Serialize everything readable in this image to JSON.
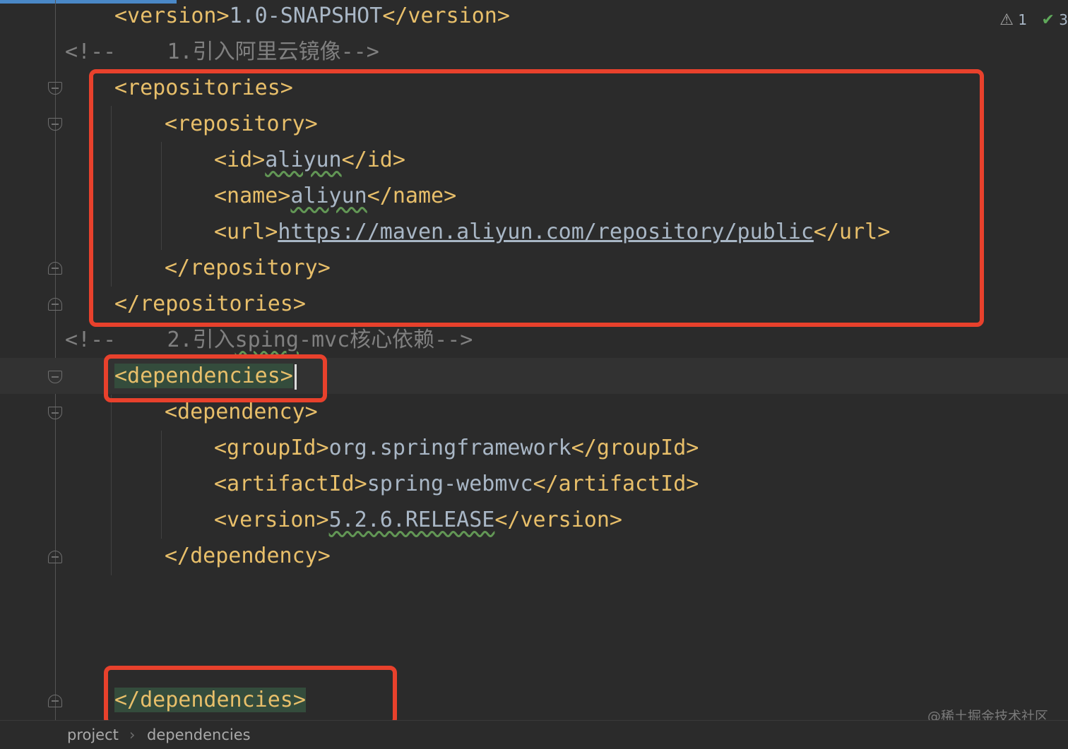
{
  "editor": {
    "lines": [
      {
        "tokens": [
          [
            "tag",
            "<version>"
          ],
          [
            "text",
            "1.0-SNAPSHOT"
          ],
          [
            "tag",
            "</version>"
          ]
        ]
      },
      {
        "tokens": [
          [
            "comment",
            "<!--    1.引入阿里云镜像-->"
          ]
        ]
      },
      {
        "tokens": [
          [
            "tag",
            "<repositories>"
          ]
        ]
      },
      {
        "tokens": [
          [
            "tag",
            "<repository>"
          ]
        ]
      },
      {
        "tokens": [
          [
            "tag",
            "<id>"
          ],
          [
            "text",
            "aliyun"
          ],
          [
            "tag",
            "</id>"
          ]
        ]
      },
      {
        "tokens": [
          [
            "tag",
            "<name>"
          ],
          [
            "text",
            "aliyun"
          ],
          [
            "tag",
            "</name>"
          ]
        ]
      },
      {
        "tokens": [
          [
            "tag",
            "<url>"
          ],
          [
            "text",
            "https://maven.aliyun.com/repository/public"
          ],
          [
            "tag",
            "</url>"
          ]
        ]
      },
      {
        "tokens": [
          [
            "tag",
            "</repository>"
          ]
        ]
      },
      {
        "tokens": [
          [
            "tag",
            "</repositories>"
          ]
        ]
      },
      {
        "tokens": [
          [
            "comment",
            "<!--    2.引入"
          ],
          [
            "comment",
            "sping"
          ],
          [
            "comment",
            "-mvc核心依赖-->"
          ]
        ]
      },
      {
        "tokens": [
          [
            "tag",
            "<dependencies>"
          ]
        ]
      },
      {
        "tokens": [
          [
            "tag",
            "<dependency>"
          ]
        ]
      },
      {
        "tokens": [
          [
            "tag",
            "<groupId>"
          ],
          [
            "text",
            "org.springframework"
          ],
          [
            "tag",
            "</groupId>"
          ]
        ]
      },
      {
        "tokens": [
          [
            "tag",
            "<artifactId>"
          ],
          [
            "text",
            "spring-webmvc"
          ],
          [
            "tag",
            "</artifactId>"
          ]
        ]
      },
      {
        "tokens": [
          [
            "tag",
            "<version>"
          ],
          [
            "text",
            "5.2.6.RELEASE"
          ],
          [
            "tag",
            "</version>"
          ]
        ]
      },
      {
        "tokens": [
          [
            "tag",
            "</dependency>"
          ]
        ]
      },
      {
        "tokens": []
      },
      {
        "tokens": []
      },
      {
        "tokens": []
      },
      {
        "tokens": [
          [
            "tag",
            "</dependencies>"
          ]
        ]
      }
    ]
  },
  "inspections": {
    "warning_count": "1",
    "ok_count": "3",
    "warning_icon": "warning-triangle-icon",
    "ok_icon": "checkmark-icon"
  },
  "breadcrumb": {
    "items": [
      "project",
      "dependencies"
    ],
    "separator": "›"
  },
  "watermark": "@稀土掘金技术社区",
  "colors": {
    "background": "#2b2b2b",
    "tag": "#e8bf6a",
    "text": "#a9b7c6",
    "comment": "#808080",
    "annotation_box": "#e8412c",
    "tag_match_highlight": "#344c3c"
  }
}
